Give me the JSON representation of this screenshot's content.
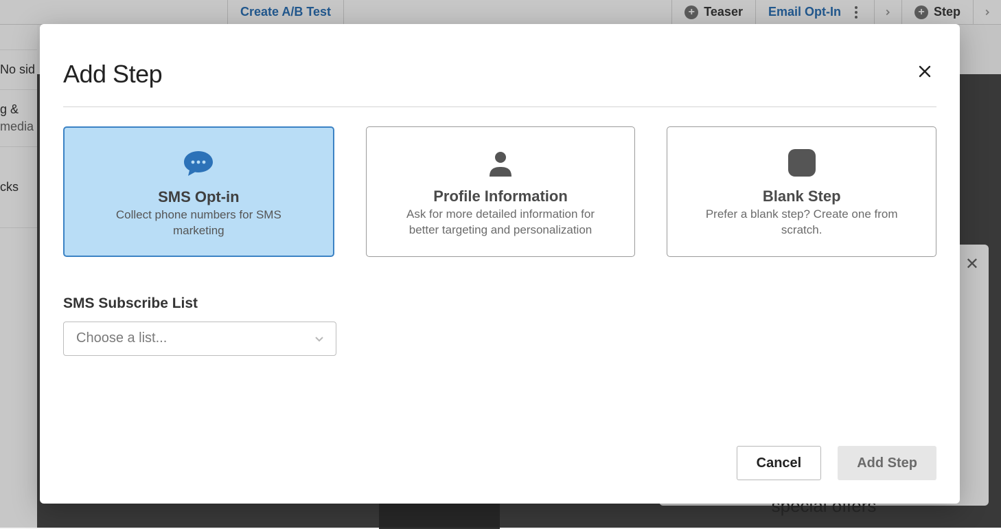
{
  "background": {
    "top_link": "Create A/B Test",
    "steps": [
      {
        "label": "Teaser"
      },
      {
        "label": "Email Opt-In",
        "active": true
      },
      {
        "label": "Step"
      }
    ],
    "sidebar_items": [
      "No sid",
      "g &",
      "media",
      "cks"
    ],
    "preview_text": "special offers"
  },
  "modal": {
    "title": "Add Step",
    "cards": [
      {
        "title": "SMS Opt-in",
        "desc": "Collect phone numbers for SMS marketing",
        "icon": "chat-bubble",
        "selected": true
      },
      {
        "title": "Profile Information",
        "desc": "Ask for more detailed information for better targeting and personalization",
        "icon": "user",
        "selected": false
      },
      {
        "title": "Blank Step",
        "desc": "Prefer a blank step? Create one from scratch.",
        "icon": "square",
        "selected": false
      }
    ],
    "form": {
      "label": "SMS Subscribe List",
      "placeholder": "Choose a list..."
    },
    "buttons": {
      "cancel": "Cancel",
      "submit": "Add Step"
    }
  }
}
